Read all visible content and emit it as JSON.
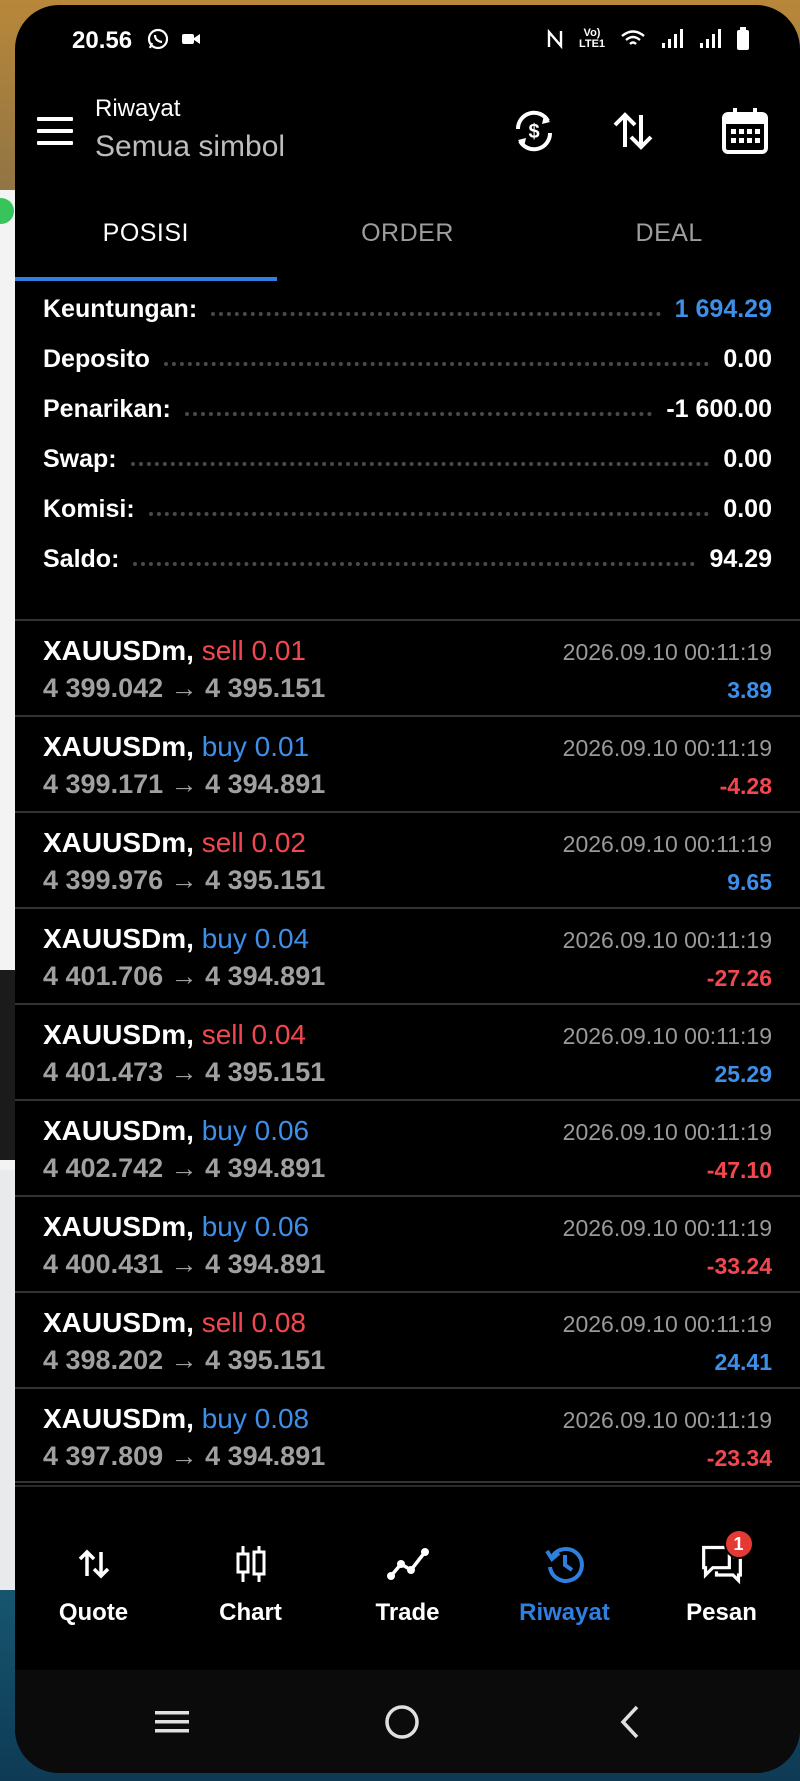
{
  "status_bar": {
    "time": "20.56",
    "icons": [
      "whatsapp-icon",
      "video-icon",
      "nfc-icon",
      "volte-icon",
      "wifi-icon",
      "signal-icon",
      "signal-icon-2",
      "battery-icon"
    ],
    "volte_text": "Vo) LTE1"
  },
  "app_bar": {
    "title": "Riwayat",
    "subtitle": "Semua simbol",
    "icons": [
      "menu-icon",
      "currency-refresh-icon",
      "sort-icon",
      "calendar-icon"
    ]
  },
  "tabs": [
    {
      "label": "POSISI",
      "active": true
    },
    {
      "label": "ORDER",
      "active": false
    },
    {
      "label": "DEAL",
      "active": false
    }
  ],
  "summary": {
    "profit_label": "Keuntungan:",
    "profit_value": "1 694.29",
    "deposit_label": "Deposito",
    "deposit_value": "0.00",
    "withdrawal_label": "Penarikan:",
    "withdrawal_value": "-1 600.00",
    "swap_label": "Swap:",
    "swap_value": "0.00",
    "commission_label": "Komisi:",
    "commission_value": "0.00",
    "balance_label": "Saldo:",
    "balance_value": "94.29"
  },
  "deals": [
    {
      "symbol": "XAUUSDm,",
      "side": "sell 0.01",
      "type": "sell",
      "prices": "4 399.042 → 4 395.151",
      "time": "2026.09.10 00:11:19",
      "pl": "3.89",
      "pl_sign": "pos"
    },
    {
      "symbol": "XAUUSDm,",
      "side": "buy 0.01",
      "type": "buy",
      "prices": "4 399.171 → 4 394.891",
      "time": "2026.09.10 00:11:19",
      "pl": "-4.28",
      "pl_sign": "neg"
    },
    {
      "symbol": "XAUUSDm,",
      "side": "sell 0.02",
      "type": "sell",
      "prices": "4 399.976 → 4 395.151",
      "time": "2026.09.10 00:11:19",
      "pl": "9.65",
      "pl_sign": "pos"
    },
    {
      "symbol": "XAUUSDm,",
      "side": "buy 0.04",
      "type": "buy",
      "prices": "4 401.706 → 4 394.891",
      "time": "2026.09.10 00:11:19",
      "pl": "-27.26",
      "pl_sign": "neg"
    },
    {
      "symbol": "XAUUSDm,",
      "side": "sell 0.04",
      "type": "sell",
      "prices": "4 401.473 → 4 395.151",
      "time": "2026.09.10 00:11:19",
      "pl": "25.29",
      "pl_sign": "pos"
    },
    {
      "symbol": "XAUUSDm,",
      "side": "buy 0.06",
      "type": "buy",
      "prices": "4 402.742 → 4 394.891",
      "time": "2026.09.10 00:11:19",
      "pl": "-47.10",
      "pl_sign": "neg"
    },
    {
      "symbol": "XAUUSDm,",
      "side": "buy 0.06",
      "type": "buy",
      "prices": "4 400.431 → 4 394.891",
      "time": "2026.09.10 00:11:19",
      "pl": "-33.24",
      "pl_sign": "neg"
    },
    {
      "symbol": "XAUUSDm,",
      "side": "sell 0.08",
      "type": "sell",
      "prices": "4 398.202 → 4 395.151",
      "time": "2026.09.10 00:11:19",
      "pl": "24.41",
      "pl_sign": "pos"
    },
    {
      "symbol": "XAUUSDm,",
      "side": "buy 0.08",
      "type": "buy",
      "prices": "4 397.809 → 4 394.891",
      "time": "2026.09.10 00:11:19",
      "pl": "-23.34",
      "pl_sign": "neg"
    }
  ],
  "bottom_nav": [
    {
      "label": "Quote",
      "icon": "quote-arrows-icon",
      "active": false
    },
    {
      "label": "Chart",
      "icon": "candlestick-icon",
      "active": false
    },
    {
      "label": "Trade",
      "icon": "trade-line-icon",
      "active": false
    },
    {
      "label": "Riwayat",
      "icon": "history-icon",
      "active": true
    },
    {
      "label": "Pesan",
      "icon": "messages-icon",
      "active": false,
      "badge": "1"
    }
  ],
  "colors": {
    "accent_blue": "#2f7fe0",
    "profit_blue": "#3d8fe9",
    "loss_red": "#f2474f",
    "background": "#000000"
  }
}
